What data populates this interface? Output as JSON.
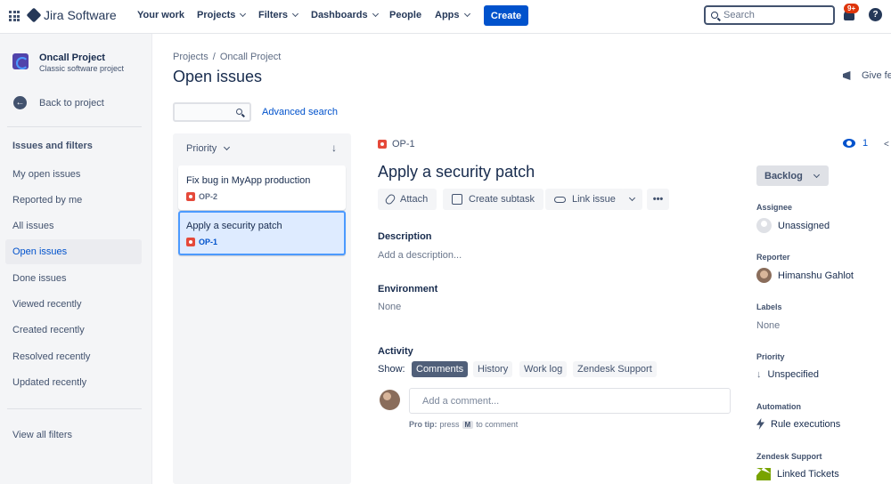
{
  "topnav": {
    "app_name": "Jira Software",
    "items": [
      {
        "label": "Your work"
      },
      {
        "label": "Projects"
      },
      {
        "label": "Filters"
      },
      {
        "label": "Dashboards"
      },
      {
        "label": "People"
      },
      {
        "label": "Apps"
      }
    ],
    "create_label": "Create",
    "search_placeholder": "Search",
    "notification_badge": "9+",
    "help_icon": "?"
  },
  "sidebar": {
    "project_name": "Oncall Project",
    "project_type": "Classic software project",
    "back_label": "Back to project",
    "section_title": "Issues and filters",
    "items": [
      {
        "label": "My open issues"
      },
      {
        "label": "Reported by me"
      },
      {
        "label": "All issues"
      },
      {
        "label": "Open issues"
      },
      {
        "label": "Done issues"
      },
      {
        "label": "Viewed recently"
      },
      {
        "label": "Created recently"
      },
      {
        "label": "Resolved recently"
      },
      {
        "label": "Updated recently"
      }
    ],
    "view_all_label": "View all filters"
  },
  "main": {
    "breadcrumb": [
      "Projects",
      "/",
      "Oncall Project"
    ],
    "title": "Open issues",
    "give_feedback": "Give fe",
    "advanced_search": "Advanced search",
    "sort_label": "Priority",
    "issues": [
      {
        "title": "Fix bug in MyApp production",
        "key": "OP-2"
      },
      {
        "title": "Apply a security patch",
        "key": "OP-1"
      }
    ]
  },
  "detail": {
    "key": "OP-1",
    "watch_count": "1",
    "title": "Apply a security patch",
    "toolbar": {
      "attach": "Attach",
      "create_subtask": "Create subtask",
      "link_issue": "Link issue",
      "more": "•••"
    },
    "description_label": "Description",
    "description_placeholder": "Add a description...",
    "environment_label": "Environment",
    "environment_value": "None",
    "activity_label": "Activity",
    "show_label": "Show:",
    "activity_tabs": [
      "Comments",
      "History",
      "Work log",
      "Zendesk Support"
    ],
    "comment_placeholder": "Add a comment...",
    "pro_tip": {
      "prefix": "Pro tip:",
      "press": "press",
      "key": "M",
      "suffix": "to comment"
    }
  },
  "fields": {
    "status": "Backlog",
    "assignee_label": "Assignee",
    "assignee_value": "Unassigned",
    "reporter_label": "Reporter",
    "reporter_value": "Himanshu Gahlot",
    "labels_label": "Labels",
    "labels_value": "None",
    "priority_label": "Priority",
    "priority_value": "Unspecified",
    "automation_label": "Automation",
    "automation_value": "Rule executions",
    "zendesk_label": "Zendesk Support",
    "zendesk_value": "Linked Tickets"
  },
  "colors": {
    "brand": "#0052CC",
    "bug": "#E5493A",
    "badge": "#DE350B"
  }
}
